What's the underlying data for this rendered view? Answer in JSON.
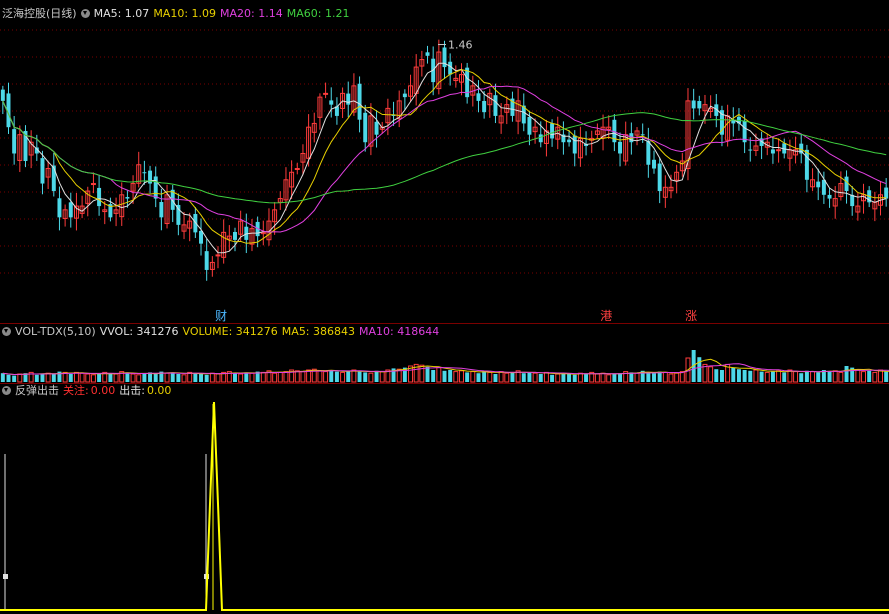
{
  "main": {
    "title": "泛海控股(日线)",
    "ma5": "MA5: 1.07",
    "ma10": "MA10: 1.09",
    "ma20": "MA20: 1.14",
    "ma60": "MA60: 1.21",
    "peak_label": "1.46",
    "markers": [
      {
        "text": "财",
        "index": 38,
        "color": "#4db8ff"
      },
      {
        "text": "港",
        "index": 106,
        "color": "#ff4040"
      },
      {
        "text": "涨",
        "index": 121,
        "color": "#ff4040"
      }
    ]
  },
  "vol": {
    "title": "VOL-TDX(5,10)",
    "vvol": "VVOL: 341276",
    "volume": "VOLUME: 341276",
    "ma5": "MA5: 386843",
    "ma10": "MA10: 418644"
  },
  "ind": {
    "title": "反弹出击",
    "watch_label": "关注:",
    "watch_value": "0.00",
    "hit_label": "出击:",
    "hit_value": "0.00"
  },
  "colors": {
    "up": "#ff3c3c",
    "down": "#4dd8e8",
    "ma5": "#e0e0e0",
    "ma10": "#e8d000",
    "ma20": "#e040e0",
    "ma60": "#40d040",
    "grid": "#7a0000",
    "signal": "#ffff00"
  },
  "chart_data": {
    "type": "candlestick",
    "price_range": [
      0.78,
      1.52
    ],
    "closes": [
      1.31,
      1.24,
      1.17,
      1.22,
      1.15,
      1.2,
      1.17,
      1.09,
      1.13,
      1.07,
      1.0,
      1.02,
      1.0,
      1.03,
      1.03,
      1.07,
      1.09,
      1.03,
      1.02,
      1.0,
      1.02,
      1.06,
      1.05,
      1.09,
      1.14,
      1.12,
      1.09,
      1.05,
      1.0,
      1.06,
      1.02,
      0.98,
      0.98,
      0.99,
      0.96,
      0.93,
      0.86,
      0.88,
      0.9,
      0.96,
      0.95,
      0.94,
      0.99,
      0.94,
      0.97,
      0.95,
      0.96,
      0.99,
      1.02,
      1.05,
      1.1,
      1.12,
      1.13,
      1.17,
      1.24,
      1.25,
      1.32,
      1.33,
      1.3,
      1.27,
      1.33,
      1.3,
      1.35,
      1.26,
      1.2,
      1.27,
      1.22,
      1.24,
      1.29,
      1.27,
      1.31,
      1.32,
      1.35,
      1.4,
      1.42,
      1.43,
      1.36,
      1.44,
      1.4,
      1.38,
      1.37,
      1.38,
      1.32,
      1.35,
      1.31,
      1.28,
      1.33,
      1.27,
      1.27,
      1.3,
      1.27,
      1.31,
      1.25,
      1.22,
      1.24,
      1.2,
      1.23,
      1.21,
      1.24,
      1.2,
      1.2,
      1.17,
      1.21,
      1.19,
      1.21,
      1.23,
      1.24,
      1.24,
      1.2,
      1.17,
      1.22,
      1.2,
      1.23,
      1.22,
      1.14,
      1.13,
      1.07,
      1.08,
      1.08,
      1.12,
      1.15,
      1.31,
      1.29,
      1.29,
      1.3,
      1.29,
      1.27,
      1.22,
      1.27,
      1.25,
      1.25,
      1.2,
      1.18,
      1.19,
      1.19,
      1.2,
      1.17,
      1.18,
      1.17,
      1.18,
      1.18,
      1.17,
      1.1,
      1.1,
      1.08,
      1.06,
      1.05,
      1.05,
      1.09,
      1.07,
      1.03,
      1.03,
      1.06,
      1.04,
      1.04,
      1.06,
      1.05
    ],
    "volumes": [
      0.22,
      0.18,
      0.16,
      0.2,
      0.22,
      0.24,
      0.18,
      0.2,
      0.22,
      0.2,
      0.26,
      0.24,
      0.2,
      0.24,
      0.22,
      0.2,
      0.18,
      0.2,
      0.24,
      0.22,
      0.2,
      0.26,
      0.24,
      0.2,
      0.18,
      0.2,
      0.24,
      0.22,
      0.26,
      0.22,
      0.24,
      0.2,
      0.18,
      0.24,
      0.22,
      0.2,
      0.18,
      0.22,
      0.2,
      0.24,
      0.26,
      0.22,
      0.2,
      0.24,
      0.22,
      0.26,
      0.24,
      0.28,
      0.22,
      0.24,
      0.26,
      0.3,
      0.28,
      0.26,
      0.3,
      0.32,
      0.28,
      0.26,
      0.3,
      0.26,
      0.24,
      0.28,
      0.3,
      0.26,
      0.24,
      0.22,
      0.28,
      0.26,
      0.3,
      0.34,
      0.32,
      0.36,
      0.4,
      0.44,
      0.42,
      0.38,
      0.3,
      0.36,
      0.28,
      0.3,
      0.26,
      0.28,
      0.24,
      0.26,
      0.22,
      0.28,
      0.24,
      0.2,
      0.26,
      0.22,
      0.24,
      0.28,
      0.22,
      0.24,
      0.22,
      0.2,
      0.24,
      0.18,
      0.2,
      0.22,
      0.2,
      0.18,
      0.22,
      0.2,
      0.24,
      0.2,
      0.22,
      0.18,
      0.2,
      0.22,
      0.26,
      0.24,
      0.22,
      0.28,
      0.24,
      0.22,
      0.26,
      0.24,
      0.2,
      0.22,
      0.26,
      0.6,
      0.8,
      0.62,
      0.44,
      0.38,
      0.32,
      0.3,
      0.44,
      0.36,
      0.32,
      0.3,
      0.28,
      0.3,
      0.26,
      0.24,
      0.26,
      0.28,
      0.24,
      0.3,
      0.26,
      0.22,
      0.28,
      0.26,
      0.24,
      0.3,
      0.26,
      0.28,
      0.24,
      0.4,
      0.36,
      0.3,
      0.26,
      0.28,
      0.24,
      0.3,
      0.26,
      0.24,
      0.28
    ]
  }
}
